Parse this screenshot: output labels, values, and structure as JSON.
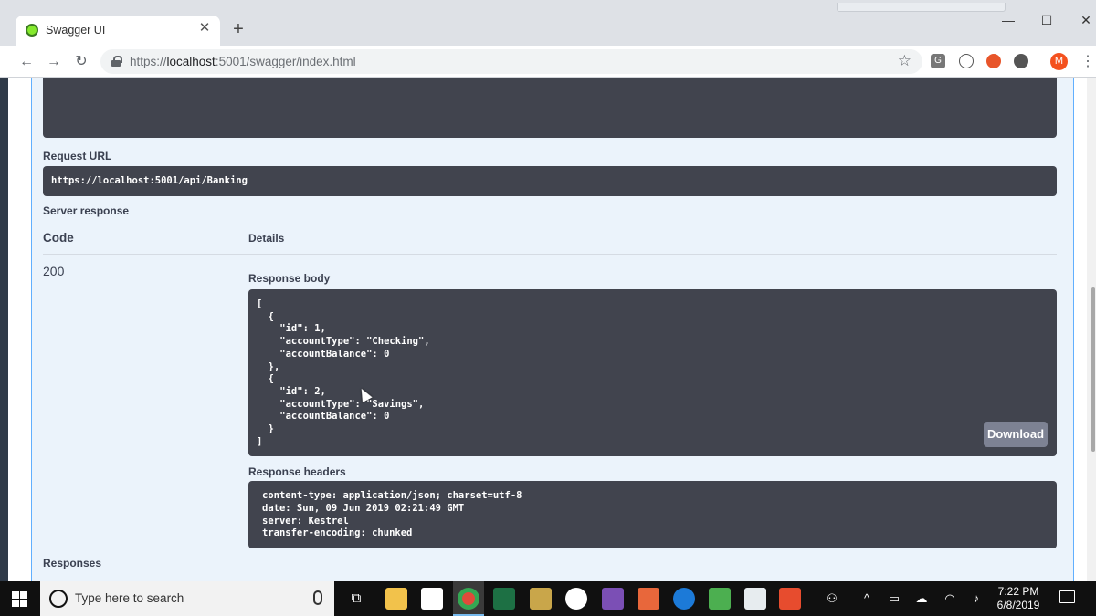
{
  "browser": {
    "tab_title": "Swagger UI",
    "tab_close": "✕",
    "new_tab": "+",
    "url_scheme": "https://",
    "url_host": "localhost",
    "url_path": ":5001/swagger/index.html",
    "profile_initial": "M",
    "ext_g": "G",
    "window_controls": {
      "minimize": "—",
      "maximize": "☐",
      "close": "✕"
    }
  },
  "swagger": {
    "request_url_label": "Request URL",
    "request_url": "https://localhost:5001/api/Banking",
    "server_response_label": "Server response",
    "code_header": "Code",
    "details_header": "Details",
    "status_code": "200",
    "response_body_label": "Response body",
    "response_body": "[\n  {\n    \"id\": 1,\n    \"accountType\": \"Checking\",\n    \"accountBalance\": 0\n  },\n  {\n    \"id\": 2,\n    \"accountType\": \"Savings\",\n    \"accountBalance\": 0\n  }\n]",
    "download_label": "Download",
    "response_headers_label": "Response headers",
    "response_headers": "content-type: application/json; charset=utf-8\ndate: Sun, 09 Jun 2019 02:21:49 GMT\nserver: Kestrel\ntransfer-encoding: chunked",
    "responses_label": "Responses"
  },
  "taskbar": {
    "search_placeholder": "Type here to search",
    "time": "7:22 PM",
    "date": "6/8/2019"
  },
  "colors": {
    "swagger_blue": "#61affe",
    "panel_bg": "#ebf3fb",
    "code_bg": "#41444e",
    "download_btn": "#7d8293"
  }
}
